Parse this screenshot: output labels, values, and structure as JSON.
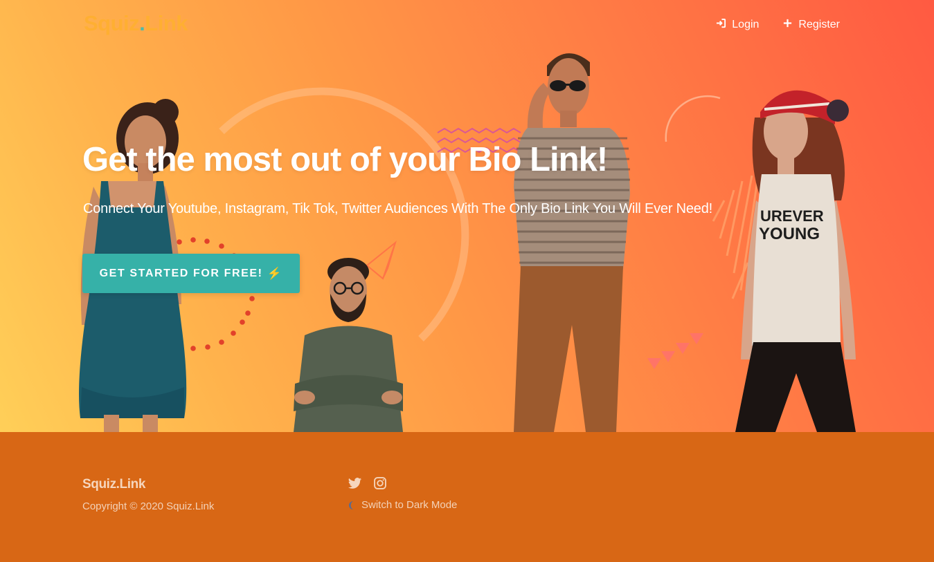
{
  "brand": {
    "name_part1": "Squiz",
    "name_dot": ".",
    "name_part2": "Link"
  },
  "nav": {
    "login": {
      "label": "Login",
      "icon": "sign-in-icon"
    },
    "register": {
      "label": "Register",
      "icon": "plus-icon"
    }
  },
  "hero": {
    "headline": "Get the most out of your Bio Link!",
    "subline": "Connect Your Youtube, Instagram, Tik Tok, Twitter Audiences With The Only Bio Link You Will Ever Need!",
    "cta_label": "GET STARTED FOR FREE!",
    "cta_emoji": "⚡",
    "shirt_text_line1": "UREVER",
    "shirt_text_line2": "YOUNG"
  },
  "footer": {
    "brand": "Squiz.Link",
    "copyright": "Copyright © 2020 Squiz.Link",
    "socials": [
      "twitter-icon",
      "instagram-icon"
    ],
    "dark_mode_label": "Switch to Dark Mode"
  },
  "colors": {
    "gradient_start": "#ffcf58",
    "gradient_end": "#ff5a42",
    "cta": "#36b1a8",
    "footer": "#d86715",
    "logo_dot": "#3bbdb2"
  }
}
